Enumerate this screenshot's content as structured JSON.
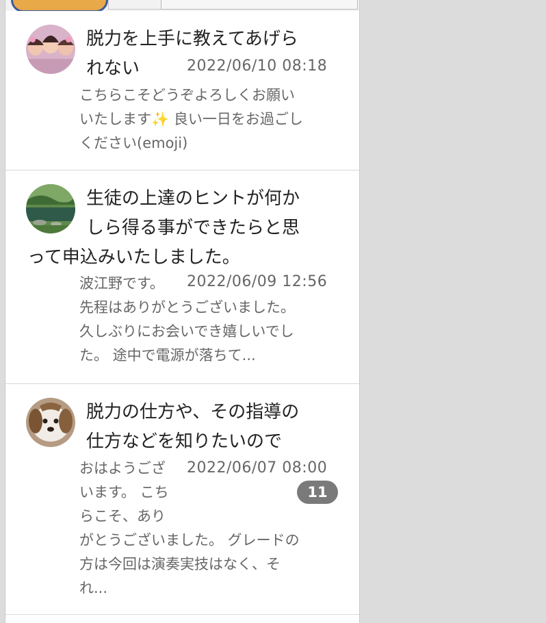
{
  "tabs": {
    "active": "",
    "second": "",
    "third": ""
  },
  "messages": [
    {
      "title_line1": "脱力を上手に教えてあげら",
      "title_line2": "れない",
      "date": "2022/06/10 08:18",
      "body_line1": "こちらこそどうぞよろしくお願い",
      "body_line2_pre": "いたします",
      "body_line2_emoji": "✨",
      "body_line2_post": " 良い一日をお過ごし",
      "body_line3": "ください(emoji)",
      "avatar_icon": "group-photo-avatar"
    },
    {
      "title_line1": "生徒の上達のヒントが何か",
      "title_line2": "しら得る事ができたらと思",
      "title_line3": "って申込みいたしました。",
      "sender": "波江野です。",
      "date": "2022/06/09 12:56",
      "body_line1": "先程はありがとうございました。",
      "body_line2": "久しぶりにお会いでき嬉しいでし",
      "body_line3": "た。 途中で電源が落ちて...",
      "avatar_icon": "garden-photo-avatar"
    },
    {
      "title_line1": "脱力の仕方や、その指導の",
      "title_line2": "仕方などを知りたいので",
      "sender": "おはようござ",
      "date": "2022/06/07 08:00",
      "body_line1": "います。 こち",
      "body_line2": "らこそ、あり",
      "body_line3": "がとうございました。 グレードの",
      "body_line4": "方は今回は演奏実技はなく、そ",
      "body_line5": "れ...",
      "badge": "11",
      "avatar_icon": "dog-photo-avatar"
    }
  ],
  "colors": {
    "background": "#dcdcdc",
    "active_tab_fill": "#e8a948",
    "active_tab_border": "#3c5a99",
    "badge": "#7a7a7a",
    "muted_text": "#666666"
  }
}
